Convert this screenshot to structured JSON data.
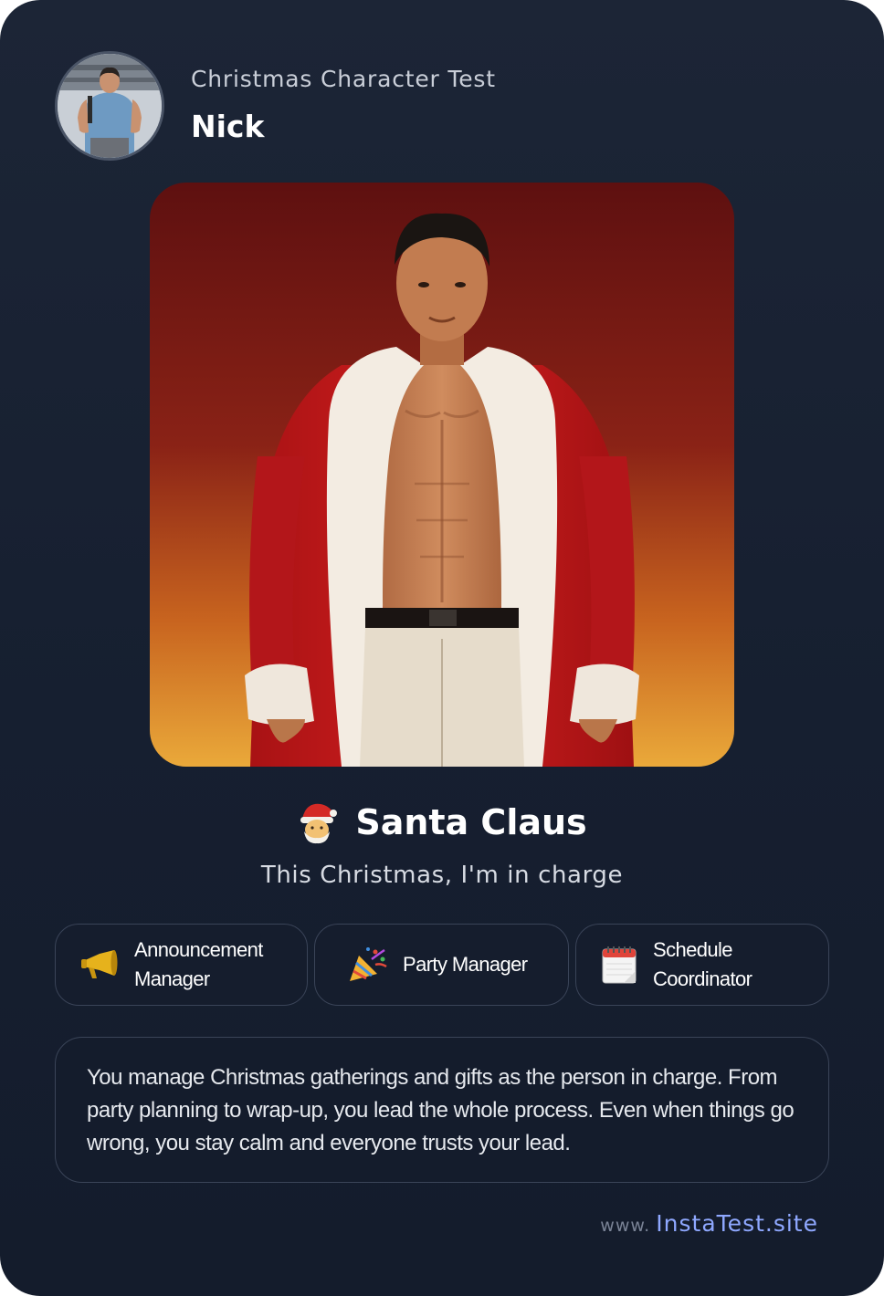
{
  "header": {
    "subtitle": "Christmas Character Test",
    "name": "Nick"
  },
  "result": {
    "emoji": "🎅",
    "title": "Santa Claus",
    "tagline": "This Christmas, I'm in charge"
  },
  "roles": [
    {
      "icon": "megaphone-icon",
      "label_line1": "Announcement",
      "label_line2": "Manager"
    },
    {
      "icon": "party-popper-icon",
      "label_line1": "Party Manager",
      "label_line2": ""
    },
    {
      "icon": "calendar-icon",
      "label_line1": "Schedule",
      "label_line2": "Coordinator"
    }
  ],
  "description": "You manage Christmas gatherings and gifts as the person in charge. From party planning to wrap-up, you lead the whole process. Even when things go wrong, you stay calm and everyone trusts your lead.",
  "footer": {
    "prefix": "www.",
    "site": "InstaTest.site"
  },
  "colors": {
    "card_background": "#1a2334",
    "accent_link": "#8fa8ff",
    "hero_top": "#6b1414",
    "hero_bottom": "#e8a838",
    "coat_red": "#c0191b"
  }
}
